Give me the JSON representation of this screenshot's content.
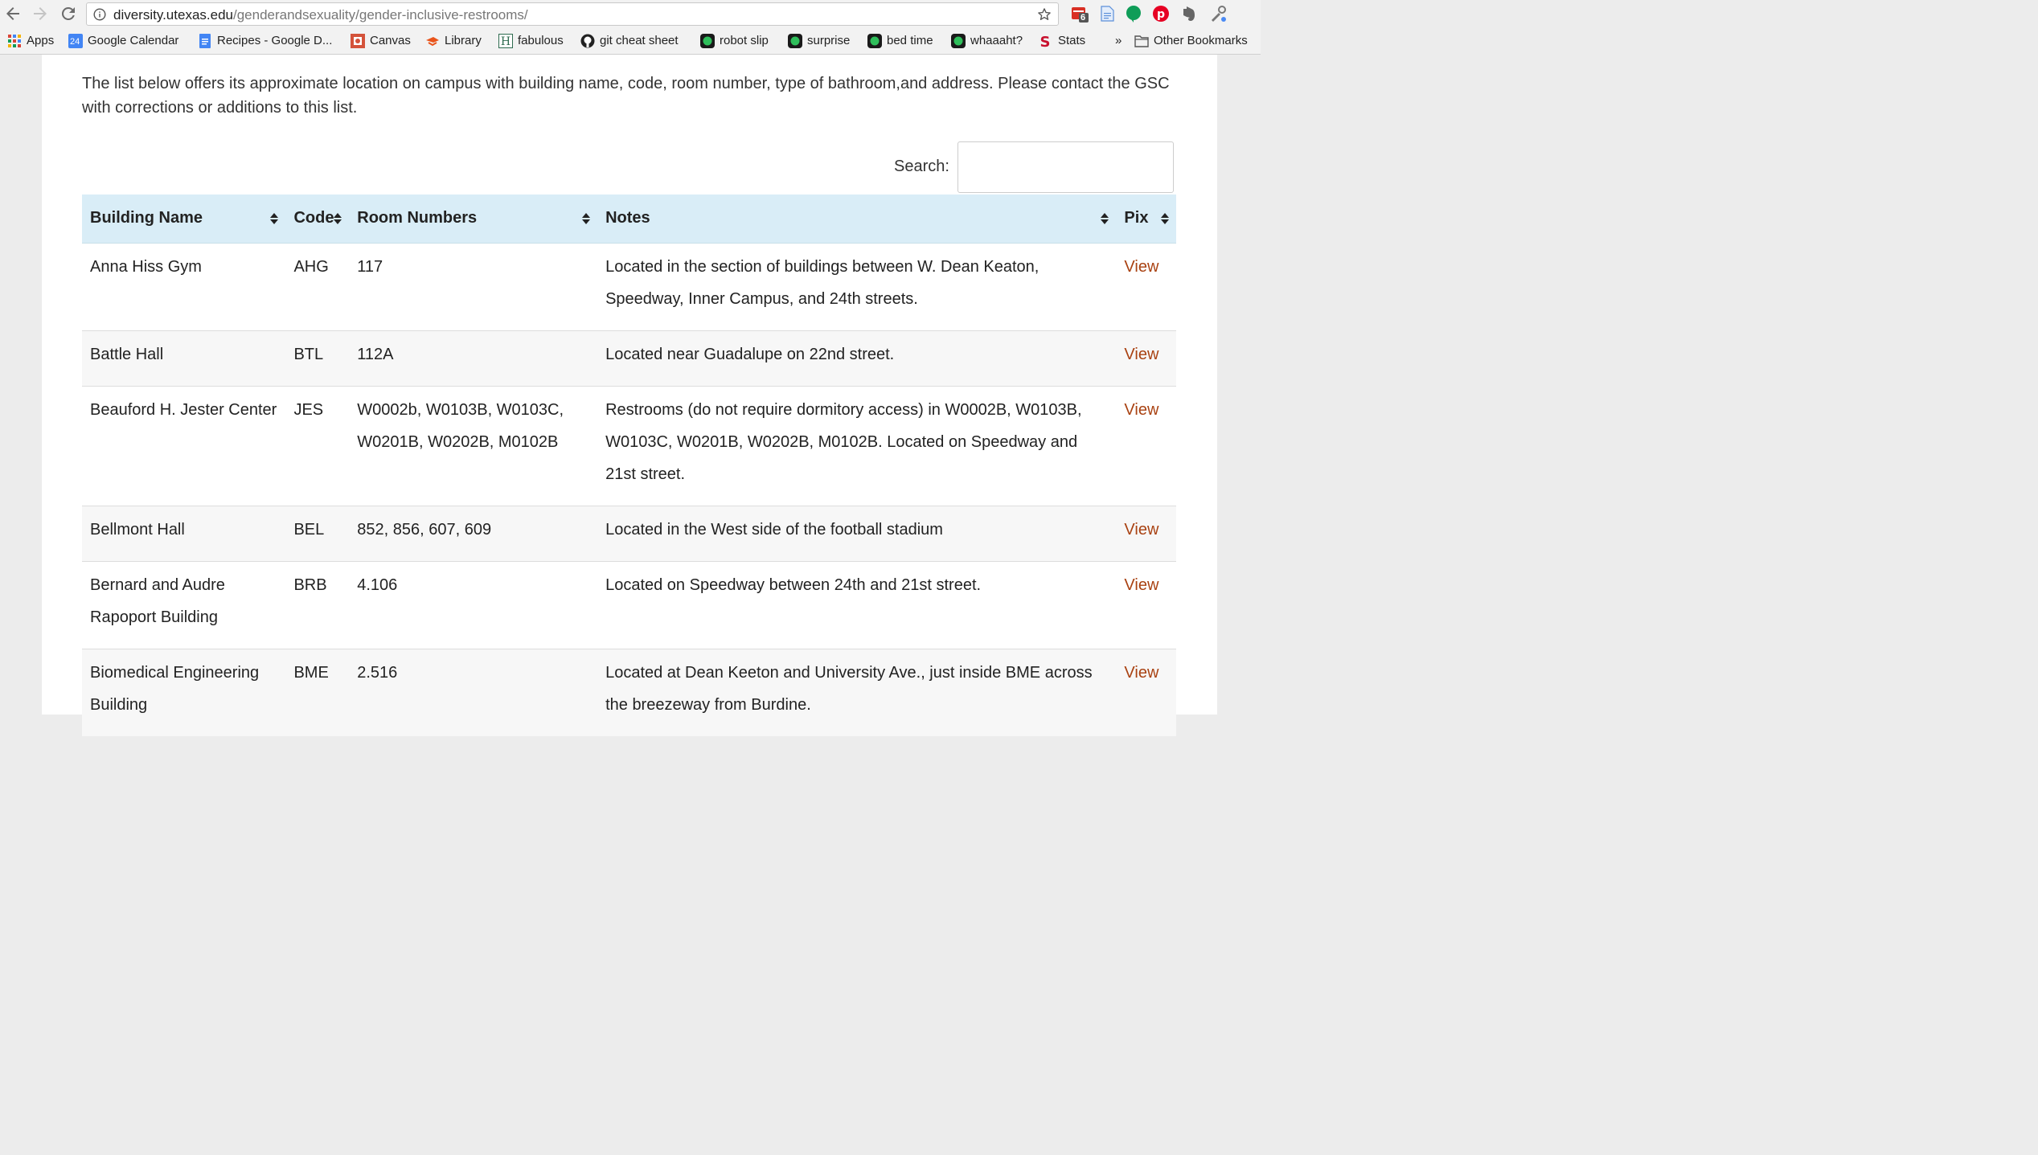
{
  "browser": {
    "url_host": "diversity.utexas.edu",
    "url_path": "/genderandsexuality/gender-inclusive-restrooms/",
    "extension_badge": "6",
    "bookmarks": [
      {
        "label": "Apps",
        "icon": "apps-grid-icon"
      },
      {
        "label": "Google Calendar",
        "icon": "calendar-icon",
        "badge": "24"
      },
      {
        "label": "Recipes - Google D...",
        "icon": "docs-icon"
      },
      {
        "label": "Canvas",
        "icon": "canvas-icon"
      },
      {
        "label": "Library",
        "icon": "library-icon"
      },
      {
        "label": "fabulous",
        "icon": "h-icon"
      },
      {
        "label": "git cheat sheet",
        "icon": "github-icon"
      },
      {
        "label": "robot slip",
        "icon": "green-dot-icon"
      },
      {
        "label": "surprise",
        "icon": "green-dot-icon"
      },
      {
        "label": "bed time",
        "icon": "green-dot-icon"
      },
      {
        "label": "whaaaht?",
        "icon": "green-dot-icon"
      },
      {
        "label": "Stats",
        "icon": "s-icon"
      }
    ],
    "overflow_label": "»",
    "other_bookmarks": "Other Bookmarks"
  },
  "page": {
    "intro": "The list below offers its approximate location on campus with building name, code, room number, type of bathroom,and address. Please contact the GSC with corrections or additions to this list.",
    "search_label": "Search:",
    "columns": {
      "name": "Building Name",
      "code": "Code",
      "rooms": "Room Numbers",
      "notes": "Notes",
      "pix": "Pix"
    },
    "rows": [
      {
        "name": "Anna Hiss Gym",
        "code": "AHG",
        "rooms": "117",
        "notes": "Located in the section of buildings between W. Dean Keaton, Speedway, Inner Campus, and 24th streets.",
        "pix": "View"
      },
      {
        "name": "Battle Hall",
        "code": "BTL",
        "rooms": "112A",
        "notes": "Located near Guadalupe on 22nd street.",
        "pix": "View"
      },
      {
        "name": "Beauford H. Jester Center",
        "code": "JES",
        "rooms": "W0002b, W0103B, W0103C, W0201B, W0202B, M0102B",
        "notes": "Restrooms (do not require dormitory access) in W0002B, W0103B, W0103C, W0201B, W0202B, M0102B. Located on Speedway and 21st street.",
        "pix": "View"
      },
      {
        "name": "Bellmont Hall",
        "code": "BEL",
        "rooms": "852, 856, 607, 609",
        "notes": "Located in the West side of the football stadium",
        "pix": "View"
      },
      {
        "name": "Bernard and Audre Rapoport Building",
        "code": "BRB",
        "rooms": "4.106",
        "notes": "Located on Speedway between 24th and 21st street.",
        "pix": "View"
      },
      {
        "name": "Biomedical Engineering Building",
        "code": "BME",
        "rooms": "2.516",
        "notes": "Located at Dean Keeton and University Ave., just inside BME across the breezeway from Burdine.",
        "pix": "View"
      }
    ],
    "link_color": "#a94212",
    "header_color": "#d9edf7"
  }
}
